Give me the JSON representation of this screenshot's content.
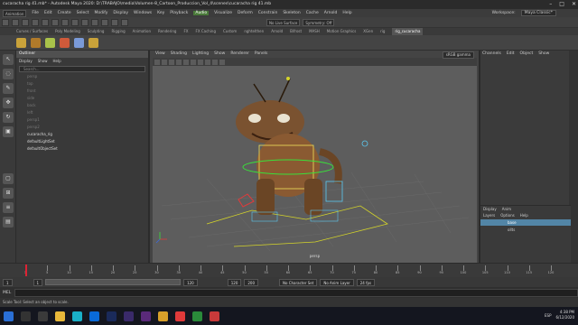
{
  "titlebar": {
    "title": "cucaracha rig 41.mb* - Autodesk Maya 2020: D:\\TRABAJO\\media\\Volumen-8_Cartoon_Produccion_Vol_4\\scenes\\cucaracha rig 41.mb"
  },
  "menubar": {
    "mode": "Animation",
    "items": [
      "File",
      "Edit",
      "Create",
      "Select",
      "Modify",
      "Display",
      "Windows",
      "Key",
      "Playback",
      "Audio",
      "Visualize",
      "Deform",
      "Constrain",
      "Skeleton",
      "Cache",
      "Arnold",
      "Help"
    ],
    "highlight": "Audio",
    "workspace_label": "Workspace:",
    "workspace": "Maya Classic*"
  },
  "statusline": {
    "live": "No Live Surface",
    "symmetry": "Symmetry: Off"
  },
  "shelf_tabs": [
    "Curves / Surfaces",
    "Poly Modeling",
    "Sculpting",
    "Rigging",
    "Animation",
    "Rendering",
    "FX",
    "FX Caching",
    "Custom",
    "nghtelthen",
    "Arnold",
    "Bifrost",
    "MASH",
    "Motion Graphics",
    "XGen",
    "rig",
    "rig_cucaracha"
  ],
  "active_shelf": "rig_cucaracha",
  "outliner": {
    "title": "Outliner",
    "menu": [
      "Display",
      "Show",
      "Help"
    ],
    "search_placeholder": "Search...",
    "items": [
      {
        "label": "persp",
        "dim": true
      },
      {
        "label": "top",
        "dim": true
      },
      {
        "label": "front",
        "dim": true
      },
      {
        "label": "side",
        "dim": true
      },
      {
        "label": "back",
        "dim": true
      },
      {
        "label": "left",
        "dim": true
      },
      {
        "label": "persp1",
        "dim": true
      },
      {
        "label": "persp2",
        "dim": true
      },
      {
        "label": "cucaracha_rig",
        "dim": false
      },
      {
        "label": "defaultLightSet",
        "dim": false
      },
      {
        "label": "defaultObjectSet",
        "dim": false
      }
    ]
  },
  "viewport": {
    "menu": [
      "View",
      "Shading",
      "Lighting",
      "Show",
      "Renderer",
      "Panels"
    ],
    "colorspace": "sRGB gamma",
    "camera": "persp"
  },
  "channel_box": {
    "menu": [
      "Channels",
      "Edit",
      "Object",
      "Show"
    ],
    "layer_tabs": [
      "Display",
      "Anim"
    ],
    "layer_menu": [
      "Layers",
      "Options",
      "Help"
    ],
    "layers": [
      {
        "name": "base",
        "selected": true
      },
      {
        "name": "ollts",
        "selected": false
      }
    ]
  },
  "timeline": {
    "ticks": [
      "1",
      "5",
      "10",
      "15",
      "20",
      "25",
      "30",
      "35",
      "40",
      "45",
      "50",
      "55",
      "60",
      "65",
      "70",
      "75",
      "80",
      "85",
      "90",
      "95",
      "100",
      "105",
      "110",
      "115",
      "120"
    ],
    "current": "1"
  },
  "range": {
    "start": "1",
    "inner_start": "1",
    "inner_end": "120",
    "end": "120",
    "extra": "200",
    "character": "No Character Set",
    "anim_layer": "No Anim Layer",
    "fps": "24 fps"
  },
  "cmdline": {
    "label": "MEL"
  },
  "helpline": {
    "text": "Scale Tool: Select an object to scale."
  },
  "taskbar": {
    "time": "4:38 PM",
    "date": "6/12/2020",
    "lang": "ESP"
  }
}
